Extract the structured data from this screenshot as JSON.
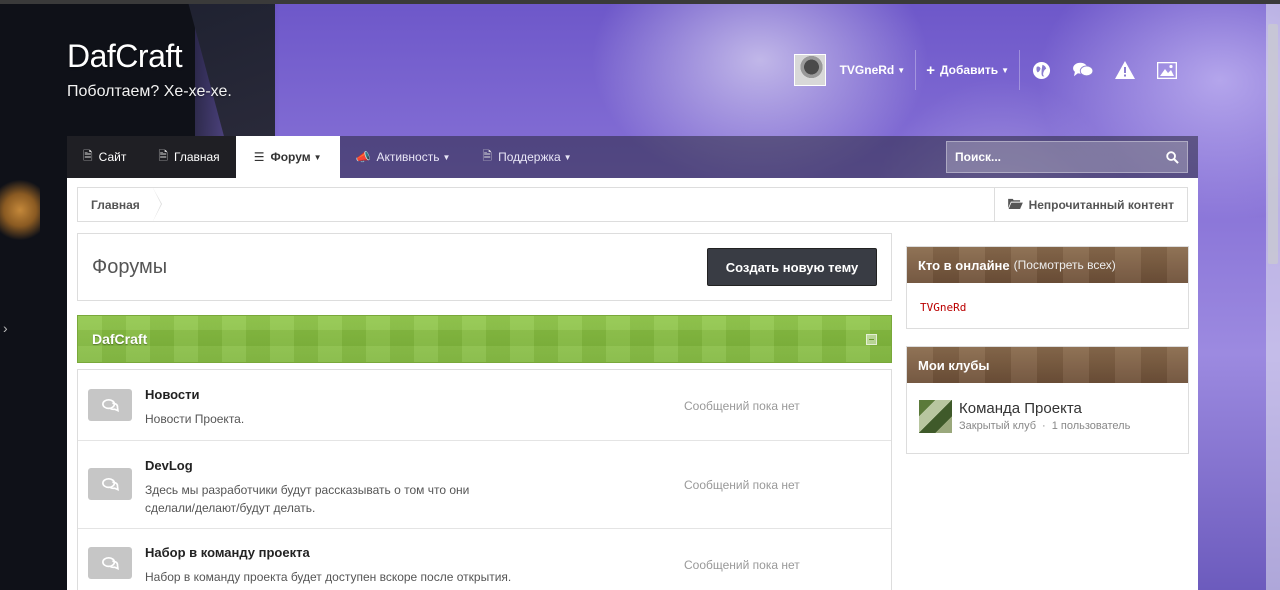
{
  "site": {
    "title": "DafCraft",
    "slogan": "Поболтаем? Хе-хе-хе."
  },
  "userbar": {
    "username": "TVGneRd",
    "add_label": "Добавить",
    "icons": [
      "globe-icon",
      "chat-icon",
      "warning-icon",
      "image-icon"
    ]
  },
  "nav": {
    "items": [
      {
        "label": "Сайт",
        "icon": "page-icon"
      },
      {
        "label": "Главная",
        "icon": "page-icon"
      },
      {
        "label": "Форум",
        "icon": "list-icon",
        "active": true
      },
      {
        "label": "Активность",
        "icon": "megaphone-icon"
      },
      {
        "label": "Поддержка",
        "icon": "page-icon"
      }
    ],
    "search_placeholder": "Поиск..."
  },
  "breadcrumb": {
    "home": "Главная",
    "unread": "Непрочитанный контент"
  },
  "page": {
    "title": "Форумы",
    "create_button": "Создать новую тему"
  },
  "category": {
    "title": "DafCraft"
  },
  "forums": [
    {
      "name": "Новости",
      "description": "Новости Проекта.",
      "status": "Сообщений пока нет"
    },
    {
      "name": "DevLog",
      "description": "Здесь мы разработчики будут рассказывать о том что они сделали/делают/будут делать.",
      "status": "Сообщений пока нет"
    },
    {
      "name": "Набор в команду проекта",
      "description": "Набор в команду проекта будет доступен вскоре после открытия.",
      "status": "Сообщений пока нет"
    }
  ],
  "sidebar": {
    "online": {
      "title": "Кто в онлайне",
      "view_all": "(Посмотреть всех)",
      "users": [
        "TVGneRd"
      ]
    },
    "clubs": {
      "title": "Мои клубы",
      "items": [
        {
          "name": "Команда Проекта",
          "type": "Закрытый клуб",
          "members": "1 пользователь"
        }
      ]
    }
  },
  "colors": {
    "category_green": "#8ec646",
    "widget_brown": "#7a5c42",
    "button_dark": "#393c44",
    "online_user_red": "#bb0000"
  }
}
